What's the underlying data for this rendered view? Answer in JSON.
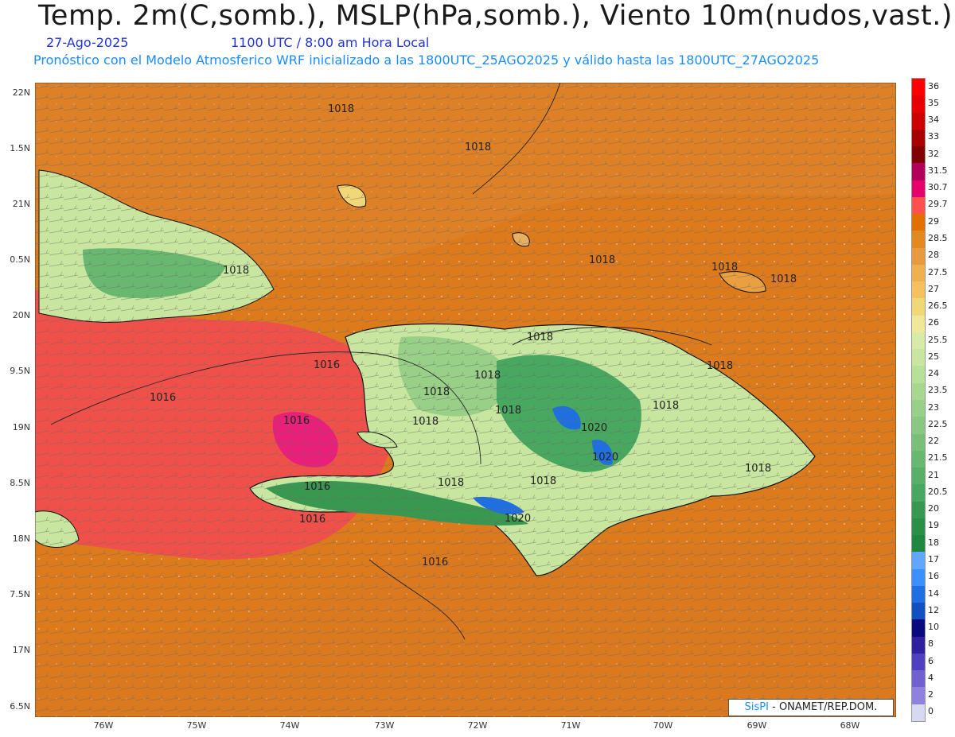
{
  "title": "Temp. 2m(C,somb.), MSLP(hPa,somb.), Viento 10m(nudos,vast.)",
  "date": "27-Ago-2025",
  "time": "1100 UTC / 8:00 am Hora Local",
  "info": "Pronóstico con el Modelo Atmosferico WRF inicializado a las 1800UTC_25AGO2025 y válido hasta las  1800UTC_27AGO2025",
  "credit": {
    "brand": "SisPI",
    "text": " - ONAMET/REP.DOM."
  },
  "lat_labels": [
    "22N",
    "1.5N",
    "21N",
    "0.5N",
    "20N",
    "9.5N",
    "19N",
    "8.5N",
    "18N",
    "7.5N",
    "17N",
    "6.5N"
  ],
  "lon_labels": [
    "76W",
    "75W",
    "74W",
    "73W",
    "72W",
    "71W",
    "70W",
    "69W",
    "68W"
  ],
  "isobars": [
    "1018",
    "1018",
    "1018",
    "1018",
    "1018",
    "1018",
    "1018",
    "1016",
    "1016",
    "1018",
    "1018",
    "1018",
    "1018",
    "1018",
    "1020",
    "1020",
    "1018",
    "1018",
    "1016",
    "1016",
    "1018",
    "1018",
    "1020",
    "1016",
    "1016"
  ],
  "colorbar": {
    "levels": [
      "36",
      "35",
      "34",
      "33",
      "32",
      "31.5",
      "30.7",
      "29.7",
      "29",
      "28.5",
      "28",
      "27.5",
      "27",
      "26.5",
      "26",
      "25.5",
      "25",
      "24",
      "23.5",
      "23",
      "22.5",
      "22",
      "21.5",
      "21",
      "20.5",
      "20",
      "19",
      "18",
      "17",
      "16",
      "14",
      "12",
      "10",
      "8",
      "6",
      "4",
      "2",
      "0"
    ],
    "colors": [
      "#ff0000",
      "#e60000",
      "#cc0000",
      "#a80000",
      "#800000",
      "#b3005a",
      "#e6006b",
      "#ff5050",
      "#e07000",
      "#e08a20",
      "#e89a40",
      "#f0b050",
      "#f5c060",
      "#f0d878",
      "#f0e898",
      "#d8eaa8",
      "#c8e6a0",
      "#b8e098",
      "#a8d890",
      "#98d088",
      "#88c880",
      "#78c078",
      "#68b870",
      "#58b068",
      "#48a860",
      "#389850",
      "#2a9048",
      "#1e8840",
      "#60a8ff",
      "#3b8fff",
      "#1f6fe0",
      "#1050c0",
      "#0a0a80",
      "#3020a0",
      "#5040c0",
      "#7060d0",
      "#9080e0",
      "#d8d8f0"
    ]
  }
}
